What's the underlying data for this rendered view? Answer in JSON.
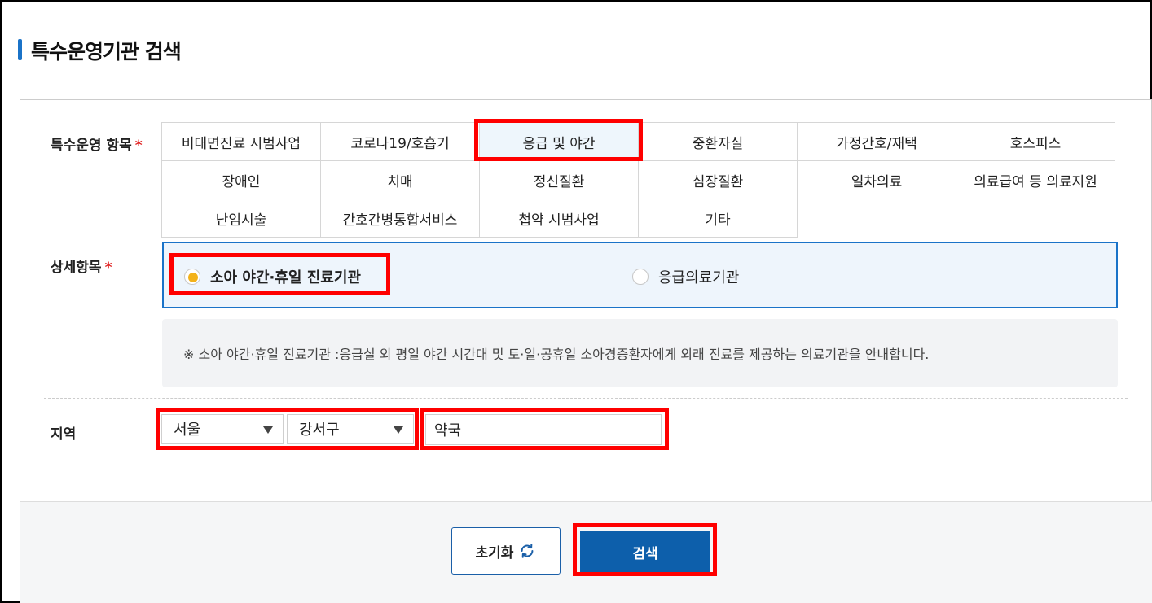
{
  "page": {
    "title": "특수운영기관 검색"
  },
  "category": {
    "label": "특수운영 항목",
    "required_mark": "*",
    "items": [
      {
        "label": "비대면진료 시범사업"
      },
      {
        "label": "코로나19/호흡기"
      },
      {
        "label": "응급 및 야간",
        "selected": true
      },
      {
        "label": "중환자실"
      },
      {
        "label": "가정간호/재택"
      },
      {
        "label": "호스피스"
      },
      {
        "label": "장애인"
      },
      {
        "label": "치매"
      },
      {
        "label": "정신질환"
      },
      {
        "label": "심장질환"
      },
      {
        "label": "일차의료"
      },
      {
        "label": "의료급여 등 의료지원"
      },
      {
        "label": "난임시술"
      },
      {
        "label": "간호간병통합서비스"
      },
      {
        "label": "첩약 시범사업"
      },
      {
        "label": "기타"
      }
    ]
  },
  "detail": {
    "label": "상세항목",
    "required_mark": "*",
    "options": [
      {
        "label": "소아 야간·휴일 진료기관",
        "checked": true
      },
      {
        "label": "응급의료기관",
        "checked": false
      }
    ],
    "notice": "※ 소아 야간·휴일 진료기관 :응급실 외 평일 야간 시간대 및 토·일·공휴일 소아경증환자에게 외래 진료를 제공하는 의료기관을 안내합니다."
  },
  "region": {
    "label": "지역",
    "city": "서울",
    "district": "강서구",
    "keyword": "약국"
  },
  "buttons": {
    "reset": "초기화",
    "search": "검색"
  },
  "colors": {
    "accent": "#1a73c8",
    "search_button": "#0d5fab",
    "highlight": "#ff0000",
    "radio_checked": "#f3b21a",
    "required": "#e02020"
  }
}
